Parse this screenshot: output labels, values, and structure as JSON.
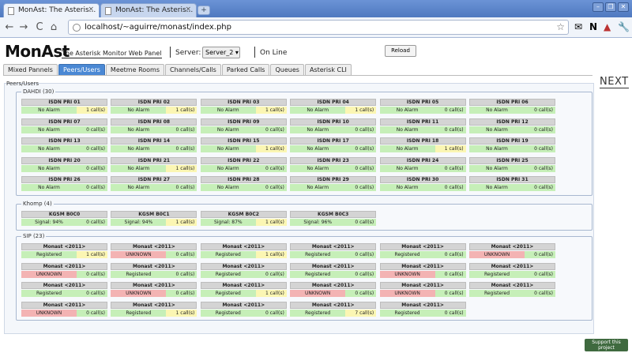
{
  "browser": {
    "tabs": [
      {
        "title": "MonAst: The Asteris...",
        "close": "×"
      },
      {
        "title": "MonAst: The Asteris...",
        "close": "×"
      }
    ],
    "url": "localhost/~aguirre/monast/index.php"
  },
  "header": {
    "logo": "MonAst",
    "subtitle": "The Asterisk Monitor Web Panel",
    "server_label": "Server:",
    "server_value": "Server_2 ▾",
    "status": "On Line",
    "reload": "Reload"
  },
  "tabs": [
    "Mixed Pannels",
    "Peers/Users",
    "Meetme Rooms",
    "Channels/Calls",
    "Parked Calls",
    "Queues",
    "Asterisk CLI"
  ],
  "active_tab": 1,
  "next_label": "NEXT",
  "peers_title": "Peers/Users",
  "groups": [
    {
      "title": "DAHDI (30)",
      "peers": [
        {
          "name": "ISDN PRI 01",
          "status": "No Alarm",
          "calls": "1 call(s)",
          "state": "ok",
          "busy": true
        },
        {
          "name": "ISDN PRI 02",
          "status": "No Alarm",
          "calls": "1 call(s)",
          "state": "ok",
          "busy": true
        },
        {
          "name": "ISDN PRI 03",
          "status": "No Alarm",
          "calls": "1 call(s)",
          "state": "ok",
          "busy": true
        },
        {
          "name": "ISDN PRI 04",
          "status": "No Alarm",
          "calls": "1 call(s)",
          "state": "ok",
          "busy": true
        },
        {
          "name": "ISDN PRI 05",
          "status": "No Alarm",
          "calls": "0 call(s)",
          "state": "ok",
          "busy": false
        },
        {
          "name": "ISDN PRI 06",
          "status": "No Alarm",
          "calls": "0 call(s)",
          "state": "ok",
          "busy": false
        },
        {
          "name": "ISDN PRI 07",
          "status": "No Alarm",
          "calls": "0 call(s)",
          "state": "ok",
          "busy": false
        },
        {
          "name": "ISDN PRI 08",
          "status": "No Alarm",
          "calls": "0 call(s)",
          "state": "ok",
          "busy": false
        },
        {
          "name": "ISDN PRI 09",
          "status": "No Alarm",
          "calls": "0 call(s)",
          "state": "ok",
          "busy": false
        },
        {
          "name": "ISDN PRI 10",
          "status": "No Alarm",
          "calls": "0 call(s)",
          "state": "ok",
          "busy": false
        },
        {
          "name": "ISDN PRI 11",
          "status": "No Alarm",
          "calls": "0 call(s)",
          "state": "ok",
          "busy": false
        },
        {
          "name": "ISDN PRI 12",
          "status": "No Alarm",
          "calls": "0 call(s)",
          "state": "ok",
          "busy": false
        },
        {
          "name": "ISDN PRI 13",
          "status": "No Alarm",
          "calls": "0 call(s)",
          "state": "ok",
          "busy": false
        },
        {
          "name": "ISDN PRI 14",
          "status": "No Alarm",
          "calls": "0 call(s)",
          "state": "ok",
          "busy": false
        },
        {
          "name": "ISDN PRI 15",
          "status": "No Alarm",
          "calls": "1 call(s)",
          "state": "ok",
          "busy": true
        },
        {
          "name": "ISDN PRI 17",
          "status": "No Alarm",
          "calls": "0 call(s)",
          "state": "ok",
          "busy": false
        },
        {
          "name": "ISDN PRI 18",
          "status": "No Alarm",
          "calls": "1 call(s)",
          "state": "ok",
          "busy": true
        },
        {
          "name": "ISDN PRI 19",
          "status": "No Alarm",
          "calls": "0 call(s)",
          "state": "ok",
          "busy": false
        },
        {
          "name": "ISDN PRI 20",
          "status": "No Alarm",
          "calls": "0 call(s)",
          "state": "ok",
          "busy": false
        },
        {
          "name": "ISDN PRI 21",
          "status": "No Alarm",
          "calls": "1 call(s)",
          "state": "ok",
          "busy": true
        },
        {
          "name": "ISDN PRI 22",
          "status": "No Alarm",
          "calls": "0 call(s)",
          "state": "ok",
          "busy": false
        },
        {
          "name": "ISDN PRI 23",
          "status": "No Alarm",
          "calls": "0 call(s)",
          "state": "ok",
          "busy": false
        },
        {
          "name": "ISDN PRI 24",
          "status": "No Alarm",
          "calls": "0 call(s)",
          "state": "ok",
          "busy": false
        },
        {
          "name": "ISDN PRI 25",
          "status": "No Alarm",
          "calls": "0 call(s)",
          "state": "ok",
          "busy": false
        },
        {
          "name": "ISDN PRI 26",
          "status": "No Alarm",
          "calls": "0 call(s)",
          "state": "ok",
          "busy": false
        },
        {
          "name": "ISDN PRI 27",
          "status": "No Alarm",
          "calls": "0 call(s)",
          "state": "ok",
          "busy": false
        },
        {
          "name": "ISDN PRI 28",
          "status": "No Alarm",
          "calls": "0 call(s)",
          "state": "ok",
          "busy": false
        },
        {
          "name": "ISDN PRI 29",
          "status": "No Alarm",
          "calls": "0 call(s)",
          "state": "ok",
          "busy": false
        },
        {
          "name": "ISDN PRI 30",
          "status": "No Alarm",
          "calls": "0 call(s)",
          "state": "ok",
          "busy": false
        },
        {
          "name": "ISDN PRI 31",
          "status": "No Alarm",
          "calls": "0 call(s)",
          "state": "ok",
          "busy": false
        }
      ]
    },
    {
      "title": "Khomp (4)",
      "peers": [
        {
          "name": "KGSM B0C0",
          "status": "Signal: 94%",
          "calls": "0 call(s)",
          "state": "ok",
          "busy": false
        },
        {
          "name": "KGSM B0C1",
          "status": "Signal: 94%",
          "calls": "1 call(s)",
          "state": "ok",
          "busy": true
        },
        {
          "name": "KGSM B0C2",
          "status": "Signal: 87%",
          "calls": "1 call(s)",
          "state": "ok",
          "busy": true
        },
        {
          "name": "KGSM B0C3",
          "status": "Signal: 96%",
          "calls": "0 call(s)",
          "state": "ok",
          "busy": false
        }
      ]
    },
    {
      "title": "SIP (23)",
      "peers": [
        {
          "name": "Monast <2011>",
          "status": "Registered",
          "calls": "1 call(s)",
          "state": "ok",
          "busy": true
        },
        {
          "name": "Monast <2011>",
          "status": "UNKNOWN",
          "calls": "0 call(s)",
          "state": "unknown",
          "busy": false
        },
        {
          "name": "Monast <2011>",
          "status": "Registered",
          "calls": "1 call(s)",
          "state": "ok",
          "busy": true
        },
        {
          "name": "Monast <2011>",
          "status": "Registered",
          "calls": "0 call(s)",
          "state": "ok",
          "busy": false
        },
        {
          "name": "Monast <2011>",
          "status": "Registered",
          "calls": "0 call(s)",
          "state": "ok",
          "busy": false
        },
        {
          "name": "Monast <2011>",
          "status": "UNKNOWN",
          "calls": "0 call(s)",
          "state": "unknown",
          "busy": false
        },
        {
          "name": "Monast <2011>",
          "status": "UNKNOWN",
          "calls": "0 call(s)",
          "state": "unknown",
          "busy": false
        },
        {
          "name": "Monast <2011>",
          "status": "Registered",
          "calls": "0 call(s)",
          "state": "ok",
          "busy": false
        },
        {
          "name": "Monast <2011>",
          "status": "Registered",
          "calls": "0 call(s)",
          "state": "ok",
          "busy": false
        },
        {
          "name": "Monast <2011>",
          "status": "Registered",
          "calls": "0 call(s)",
          "state": "ok",
          "busy": false
        },
        {
          "name": "Monast <2011>",
          "status": "UNKNOWN",
          "calls": "0 call(s)",
          "state": "unknown",
          "busy": false
        },
        {
          "name": "Monast <2011>",
          "status": "Registered",
          "calls": "0 call(s)",
          "state": "ok",
          "busy": false
        },
        {
          "name": "Monast <2011>",
          "status": "Registered",
          "calls": "0 call(s)",
          "state": "ok",
          "busy": false
        },
        {
          "name": "Monast <2011>",
          "status": "UNKNOWN",
          "calls": "0 call(s)",
          "state": "unknown",
          "busy": false
        },
        {
          "name": "Monast <2011>",
          "status": "Registered",
          "calls": "1 call(s)",
          "state": "ok",
          "busy": true
        },
        {
          "name": "Monast <2011>",
          "status": "UNKNOWN",
          "calls": "0 call(s)",
          "state": "unknown",
          "busy": false
        },
        {
          "name": "Monast <2011>",
          "status": "UNKNOWN",
          "calls": "0 call(s)",
          "state": "unknown",
          "busy": false
        },
        {
          "name": "Monast <2011>",
          "status": "Registered",
          "calls": "0 call(s)",
          "state": "ok",
          "busy": false
        },
        {
          "name": "Monast <2011>",
          "status": "UNKNOWN",
          "calls": "0 call(s)",
          "state": "unknown",
          "busy": false
        },
        {
          "name": "Monast <2011>",
          "status": "Registered",
          "calls": "1 call(s)",
          "state": "ok",
          "busy": true
        },
        {
          "name": "Monast <2011>",
          "status": "Registered",
          "calls": "0 call(s)",
          "state": "ok",
          "busy": false
        },
        {
          "name": "Monast <2011>",
          "status": "Registered",
          "calls": "7 call(s)",
          "state": "ok",
          "busy": true
        },
        {
          "name": "Monast <2011>",
          "status": "Registered",
          "calls": "0 call(s)",
          "state": "ok",
          "busy": false
        }
      ]
    }
  ],
  "support_label": "Support this project",
  "colors": {
    "ok": "#c6efb8",
    "unknown": "#f3b3b3",
    "busy": "#fbf6b3",
    "active_tab": "#4a88d4"
  }
}
